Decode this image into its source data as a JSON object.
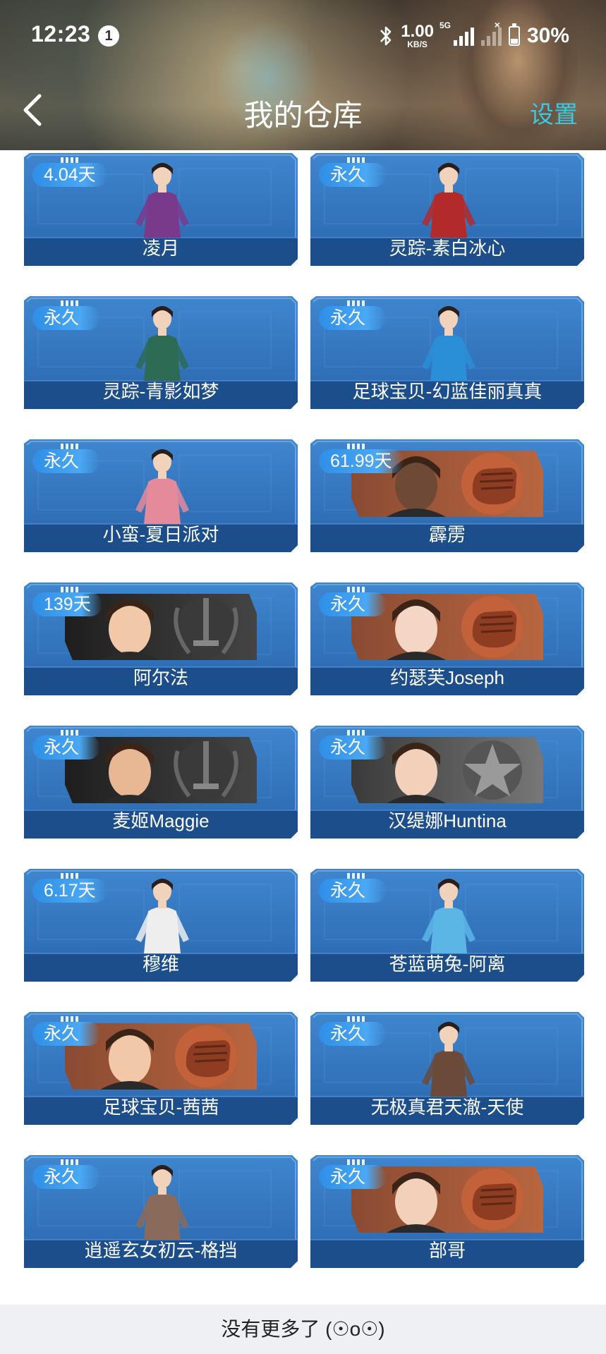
{
  "status_bar": {
    "time": "12:23",
    "notification_count": "1",
    "net_speed_value": "1.00",
    "net_speed_unit": "KB/S",
    "network_type": "5G",
    "battery": "30%"
  },
  "nav": {
    "title": "我的仓库",
    "settings_label": "设置"
  },
  "colors": {
    "card_blue": "#2f6fb5",
    "card_dark_band": "#1d4e8c",
    "badge_blue": "#3b9cf0",
    "settings_cyan": "#37c9e8"
  },
  "items": [
    {
      "name": "凌月",
      "duration": "4.04天",
      "style": "portrait",
      "icon": "female-agent-portrait-icon"
    },
    {
      "name": "灵踪-素白冰心",
      "duration": "永久",
      "style": "portrait",
      "icon": "red-dress-portrait-icon"
    },
    {
      "name": "灵踪-青影如梦",
      "duration": "永久",
      "style": "portrait",
      "icon": "green-dress-portrait-icon"
    },
    {
      "name": "足球宝贝-幻蓝佳丽真真",
      "duration": "永久",
      "style": "portrait",
      "icon": "football-jersey-portrait-icon"
    },
    {
      "name": "小蛮-夏日派对",
      "duration": "永久",
      "style": "portrait",
      "icon": "summer-outfit-portrait-icon"
    },
    {
      "name": "霹雳",
      "duration": "61.99天",
      "style": "banner",
      "emblem": "fist",
      "icon": "red-bandana-soldier-icon"
    },
    {
      "name": "阿尔法",
      "duration": "139天",
      "style": "banner",
      "emblem": "sword",
      "icon": "masked-soldier-icon"
    },
    {
      "name": "约瑟芙Joseph",
      "duration": "永久",
      "style": "banner",
      "emblem": "fist",
      "icon": "white-hair-girl-icon"
    },
    {
      "name": "麦姬Maggie",
      "duration": "永久",
      "style": "banner",
      "emblem": "sword",
      "icon": "pirate-hat-girl-icon"
    },
    {
      "name": "汉缇娜Huntina",
      "duration": "永久",
      "style": "banner",
      "emblem": "star",
      "icon": "silver-hair-girl-icon"
    },
    {
      "name": "穆维",
      "duration": "6.17天",
      "style": "portrait",
      "icon": "white-suit-portrait-icon"
    },
    {
      "name": "苍蓝萌兔-阿离",
      "duration": "永久",
      "style": "portrait",
      "icon": "twin-tail-girl-portrait-icon"
    },
    {
      "name": "足球宝贝-茜茜",
      "duration": "永久",
      "style": "banner",
      "emblem": "fist",
      "icon": "visor-girl-icon"
    },
    {
      "name": "无极真君天澈-天使",
      "duration": "永久",
      "style": "portrait",
      "icon": "armored-warrior-portrait-icon"
    },
    {
      "name": "逍遥玄女初云-格挡",
      "duration": "永久",
      "style": "portrait",
      "icon": "swordswoman-portrait-icon"
    },
    {
      "name": "部哥",
      "duration": "永久",
      "style": "banner",
      "emblem": "fist",
      "icon": "headset-man-icon"
    }
  ],
  "footer": {
    "text": "没有更多了 (☉o☉)"
  }
}
